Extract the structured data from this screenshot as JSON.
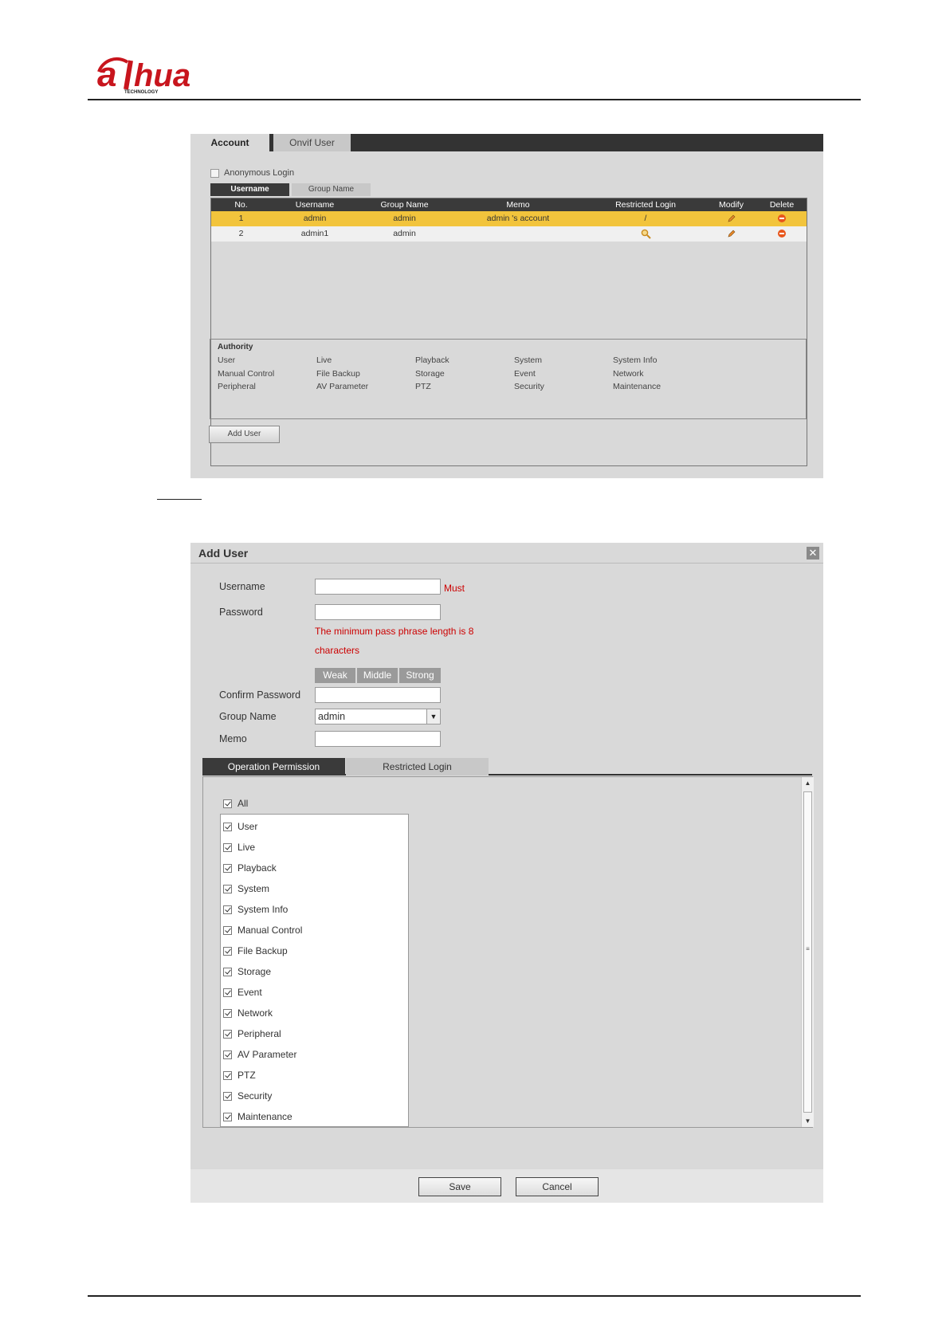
{
  "logo": {
    "text": "alhua",
    "subtext": "TECHNOLOGY",
    "color": "#c8151d"
  },
  "account_panel": {
    "tabs": [
      "Account",
      "Onvif User"
    ],
    "anonymous_login": "Anonymous Login",
    "sub_tabs": [
      "Username",
      "Group Name"
    ],
    "table": {
      "headers": [
        "No.",
        "Username",
        "Group Name",
        "Memo",
        "Restricted Login",
        "Modify",
        "Delete"
      ],
      "rows": [
        {
          "no": "1",
          "username": "admin",
          "group": "admin",
          "memo": "admin 's account",
          "restricted": "/"
        },
        {
          "no": "2",
          "username": "admin1",
          "group": "admin",
          "memo": "",
          "restricted": ""
        }
      ]
    },
    "authority": {
      "title": "Authority",
      "items": [
        "User",
        "Live",
        "Playback",
        "System",
        "System Info",
        "Manual Control",
        "File Backup",
        "Storage",
        "Event",
        "Network",
        "Peripheral",
        "AV Parameter",
        "PTZ",
        "Security",
        "Maintenance"
      ]
    },
    "add_user_button": "Add User"
  },
  "dialog": {
    "title": "Add User",
    "close": "✕",
    "labels": {
      "username": "Username",
      "password": "Password",
      "confirm": "Confirm Password",
      "group": "Group Name",
      "memo": "Memo"
    },
    "must": "Must",
    "pw_hint_line1": "The minimum pass phrase length is 8",
    "pw_hint_line2": "characters",
    "strength": [
      "Weak",
      "Middle",
      "Strong"
    ],
    "group_value": "admin",
    "tabs": [
      "Operation Permission",
      "Restricted Login"
    ],
    "all_label": "All",
    "permissions": [
      "User",
      "Live",
      "Playback",
      "System",
      "System Info",
      "Manual Control",
      "File Backup",
      "Storage",
      "Event",
      "Network",
      "Peripheral",
      "AV Parameter",
      "PTZ",
      "Security",
      "Maintenance"
    ],
    "save": "Save",
    "cancel": "Cancel"
  },
  "colors": {
    "highlight_row": "#f2c43c",
    "dark_tab": "#3a3a3a",
    "panel_bg": "#d9d9d9",
    "error_red": "#cc0000"
  },
  "icons": {
    "modify": "pencil-icon",
    "delete": "delete-icon",
    "restricted": "magnifier-icon",
    "select": "dropdown-arrow-icon"
  }
}
